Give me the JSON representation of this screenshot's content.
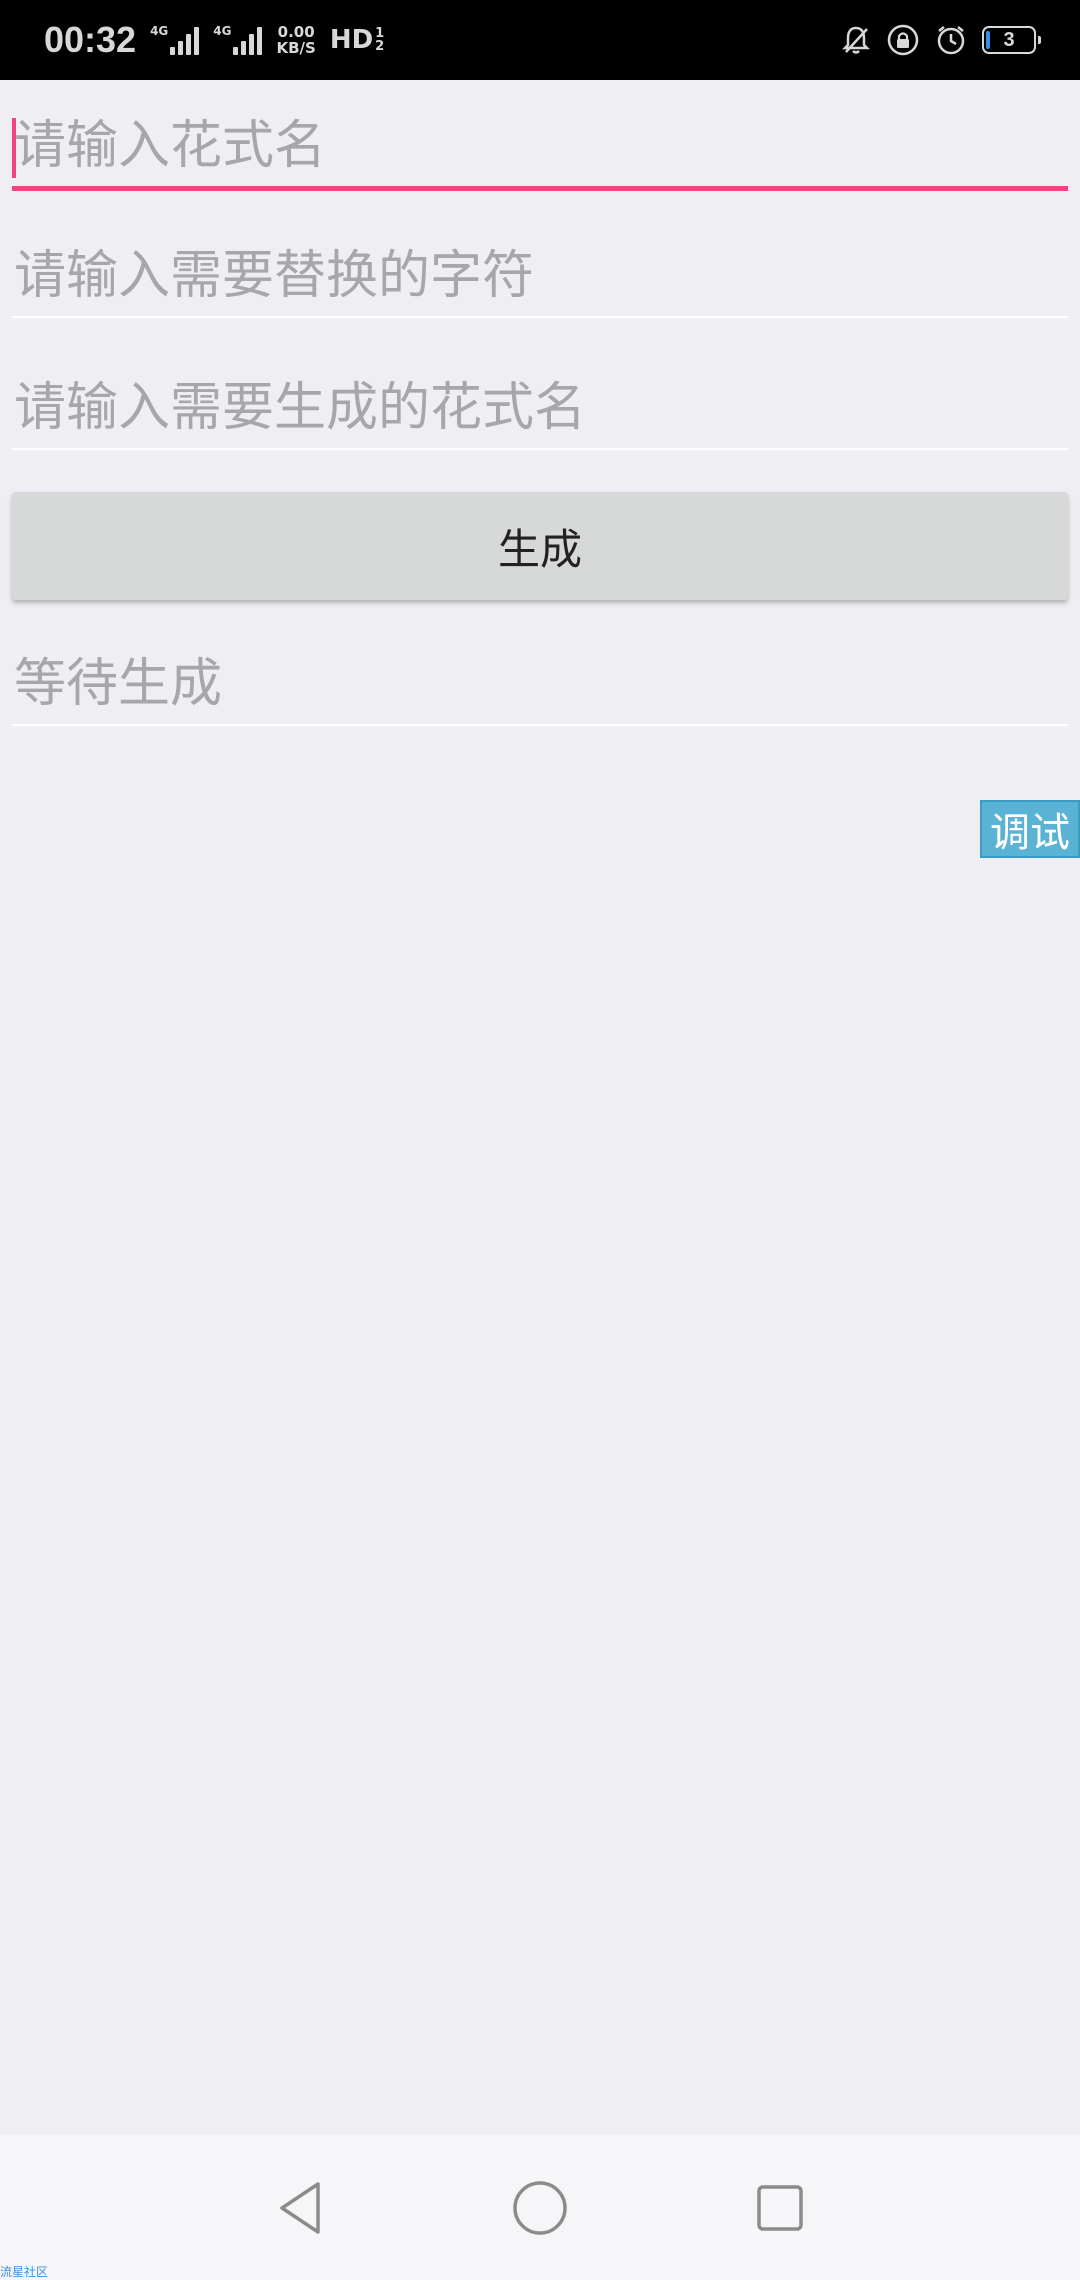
{
  "status_bar": {
    "time": "00:32",
    "network_1": "4G",
    "network_2": "4G",
    "speed_value": "0.00",
    "speed_unit": "KB/S",
    "hd_label": "HD",
    "hd_sub_1": "1",
    "hd_sub_2": "2",
    "battery_level": "3",
    "icons": [
      "bell-off-icon",
      "lock-rotation-icon",
      "alarm-icon",
      "battery-icon"
    ]
  },
  "form": {
    "pattern_name_placeholder": "请输入花式名",
    "replace_char_placeholder": "请输入需要替换的字符",
    "output_name_placeholder": "请输入需要生成的花式名",
    "generate_label": "生成",
    "result_placeholder": "等待生成"
  },
  "debug_tag": "调试",
  "nav_bar": {
    "icons": [
      "back-icon",
      "home-icon",
      "recents-icon"
    ]
  },
  "watermark": "流星社区",
  "colors": {
    "accent": "#ee4780",
    "debug": "#5ab3d4",
    "background": "#efeef3"
  }
}
